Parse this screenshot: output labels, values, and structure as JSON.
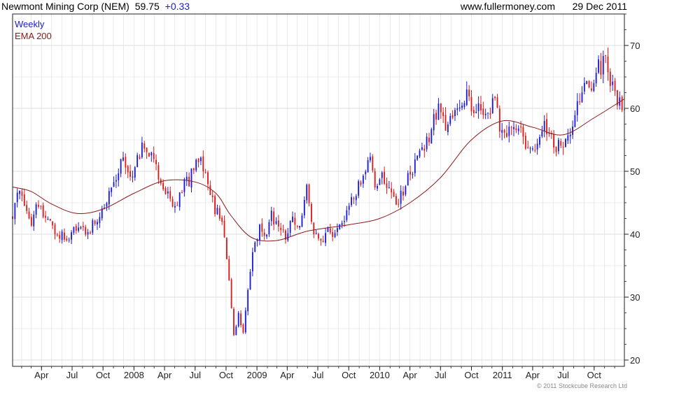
{
  "header": {
    "title": "Newmont Mining Corp (NEM)",
    "last_price": "59.75",
    "change": "+0.33",
    "website": "www.fullermoney.com",
    "date": "29 Dec 2011"
  },
  "legend": {
    "period_label": "Weekly",
    "indicator_label": "EMA 200"
  },
  "footer": {
    "copyright": "© 2011 Stockcube Research Ltd"
  },
  "colors": {
    "up": "#1a1adc",
    "down": "#e01818",
    "ema": "#8b1a1a",
    "grid": "#dcdcdc",
    "frame": "#222222",
    "change": "#1a1adc",
    "weekly_label": "#1a1adc",
    "ema_label": "#8b1a1a"
  },
  "chart_data": {
    "type": "candlestick",
    "title": "Newmont Mining Corp (NEM)",
    "xlabel": "",
    "ylabel": "",
    "x_range": [
      "2007-01-05",
      "2011-12-30"
    ],
    "ylim": [
      19,
      75
    ],
    "y_ticks": [
      20,
      30,
      40,
      50,
      60,
      70
    ],
    "grid": true,
    "legend_position": "top-left",
    "x_ticks": [
      {
        "label": "Apr",
        "date": "2007-04-01"
      },
      {
        "label": "Jul",
        "date": "2007-07-01"
      },
      {
        "label": "Oct",
        "date": "2007-10-01"
      },
      {
        "label": "2008",
        "date": "2008-01-01"
      },
      {
        "label": "Apr",
        "date": "2008-04-01"
      },
      {
        "label": "Jul",
        "date": "2008-07-01"
      },
      {
        "label": "Oct",
        "date": "2008-10-01"
      },
      {
        "label": "2009",
        "date": "2009-01-01"
      },
      {
        "label": "Apr",
        "date": "2009-04-01"
      },
      {
        "label": "Jul",
        "date": "2009-07-01"
      },
      {
        "label": "Oct",
        "date": "2009-10-01"
      },
      {
        "label": "2010",
        "date": "2010-01-01"
      },
      {
        "label": "Apr",
        "date": "2010-04-01"
      },
      {
        "label": "Jul",
        "date": "2010-07-01"
      },
      {
        "label": "Oct",
        "date": "2010-10-01"
      },
      {
        "label": "2011",
        "date": "2011-01-01"
      },
      {
        "label": "Apr",
        "date": "2011-04-01"
      },
      {
        "label": "Jul",
        "date": "2011-07-01"
      },
      {
        "label": "Oct",
        "date": "2011-10-01"
      }
    ],
    "price_path": [
      [
        "2007-01-05",
        43.0
      ],
      [
        "2007-01-19",
        46.0
      ],
      [
        "2007-02-02",
        47.0
      ],
      [
        "2007-02-16",
        43.0
      ],
      [
        "2007-03-02",
        42.0
      ],
      [
        "2007-03-16",
        44.0
      ],
      [
        "2007-04-06",
        43.5
      ],
      [
        "2007-04-27",
        41.5
      ],
      [
        "2007-05-18",
        40.0
      ],
      [
        "2007-06-15",
        39.5
      ],
      [
        "2007-07-06",
        40.5
      ],
      [
        "2007-07-27",
        41.5
      ],
      [
        "2007-08-17",
        40.0
      ],
      [
        "2007-09-07",
        42.0
      ],
      [
        "2007-09-28",
        44.5
      ],
      [
        "2007-10-19",
        46.5
      ],
      [
        "2007-11-09",
        48.5
      ],
      [
        "2007-11-23",
        52.5
      ],
      [
        "2007-12-07",
        51.5
      ],
      [
        "2007-12-21",
        49.5
      ],
      [
        "2008-01-11",
        51.5
      ],
      [
        "2008-01-25",
        54.5
      ],
      [
        "2008-02-08",
        52.5
      ],
      [
        "2008-02-29",
        51.5
      ],
      [
        "2008-03-21",
        47.5
      ],
      [
        "2008-04-11",
        47.0
      ],
      [
        "2008-05-02",
        44.5
      ],
      [
        "2008-05-23",
        47.5
      ],
      [
        "2008-06-13",
        48.5
      ],
      [
        "2008-07-04",
        51.5
      ],
      [
        "2008-07-18",
        52.5
      ],
      [
        "2008-08-08",
        47.5
      ],
      [
        "2008-08-29",
        44.0
      ],
      [
        "2008-09-19",
        42.0
      ],
      [
        "2008-10-10",
        33.0
      ],
      [
        "2008-10-24",
        24.0
      ],
      [
        "2008-11-07",
        27.0
      ],
      [
        "2008-11-21",
        24.5
      ],
      [
        "2008-12-05",
        31.0
      ],
      [
        "2008-12-19",
        37.0
      ],
      [
        "2009-01-09",
        41.0
      ],
      [
        "2009-01-23",
        39.0
      ],
      [
        "2009-02-13",
        43.0
      ],
      [
        "2009-03-06",
        41.0
      ],
      [
        "2009-03-27",
        39.5
      ],
      [
        "2009-04-17",
        42.5
      ],
      [
        "2009-05-08",
        40.5
      ],
      [
        "2009-05-29",
        47.0
      ],
      [
        "2009-06-19",
        40.5
      ],
      [
        "2009-07-10",
        38.5
      ],
      [
        "2009-07-31",
        41.0
      ],
      [
        "2009-08-21",
        39.5
      ],
      [
        "2009-09-11",
        42.0
      ],
      [
        "2009-10-02",
        44.0
      ],
      [
        "2009-10-23",
        47.0
      ],
      [
        "2009-11-13",
        48.5
      ],
      [
        "2009-12-04",
        52.0
      ],
      [
        "2009-12-18",
        48.5
      ],
      [
        "2010-01-08",
        49.0
      ],
      [
        "2010-01-29",
        46.5
      ],
      [
        "2010-02-19",
        45.0
      ],
      [
        "2010-03-12",
        47.0
      ],
      [
        "2010-04-02",
        49.5
      ],
      [
        "2010-04-23",
        52.5
      ],
      [
        "2010-05-14",
        54.5
      ],
      [
        "2010-06-04",
        56.5
      ],
      [
        "2010-06-25",
        61.0
      ],
      [
        "2010-07-16",
        57.0
      ],
      [
        "2010-08-06",
        58.0
      ],
      [
        "2010-08-27",
        61.0
      ],
      [
        "2010-09-17",
        62.5
      ],
      [
        "2010-10-08",
        60.0
      ],
      [
        "2010-10-29",
        60.5
      ],
      [
        "2010-11-19",
        59.5
      ],
      [
        "2010-12-10",
        61.0
      ],
      [
        "2010-12-24",
        57.0
      ],
      [
        "2011-01-14",
        56.5
      ],
      [
        "2011-02-04",
        56.0
      ],
      [
        "2011-02-25",
        57.0
      ],
      [
        "2011-03-18",
        53.5
      ],
      [
        "2011-04-08",
        54.5
      ],
      [
        "2011-04-29",
        57.5
      ],
      [
        "2011-05-20",
        56.5
      ],
      [
        "2011-06-10",
        53.5
      ],
      [
        "2011-07-01",
        54.5
      ],
      [
        "2011-07-22",
        56.0
      ],
      [
        "2011-08-12",
        60.0
      ],
      [
        "2011-08-26",
        63.0
      ],
      [
        "2011-09-09",
        65.5
      ],
      [
        "2011-09-23",
        63.5
      ],
      [
        "2011-10-07",
        67.0
      ],
      [
        "2011-10-21",
        66.5
      ],
      [
        "2011-11-04",
        68.0
      ],
      [
        "2011-11-18",
        64.5
      ],
      [
        "2011-12-02",
        63.0
      ],
      [
        "2011-12-16",
        60.5
      ],
      [
        "2011-12-30",
        59.75
      ]
    ],
    "ema_series": {
      "name": "EMA 200",
      "points": [
        [
          "2007-01-05",
          47.5
        ],
        [
          "2007-03-01",
          46.8
        ],
        [
          "2007-05-01",
          44.8
        ],
        [
          "2007-07-15",
          43.3
        ],
        [
          "2007-10-01",
          44.0
        ],
        [
          "2008-01-01",
          46.5
        ],
        [
          "2008-04-01",
          48.5
        ],
        [
          "2008-07-01",
          48.3
        ],
        [
          "2008-09-01",
          46.5
        ],
        [
          "2008-10-15",
          43.0
        ],
        [
          "2008-12-15",
          39.5
        ],
        [
          "2009-03-01",
          39.0
        ],
        [
          "2009-06-01",
          40.5
        ],
        [
          "2009-10-01",
          41.5
        ],
        [
          "2010-01-01",
          42.5
        ],
        [
          "2010-04-01",
          45.0
        ],
        [
          "2010-07-01",
          49.0
        ],
        [
          "2010-10-01",
          55.0
        ],
        [
          "2011-01-01",
          58.0
        ],
        [
          "2011-04-01",
          57.0
        ],
        [
          "2011-07-01",
          55.8
        ],
        [
          "2011-10-01",
          58.5
        ],
        [
          "2011-12-30",
          61.5
        ]
      ]
    }
  }
}
